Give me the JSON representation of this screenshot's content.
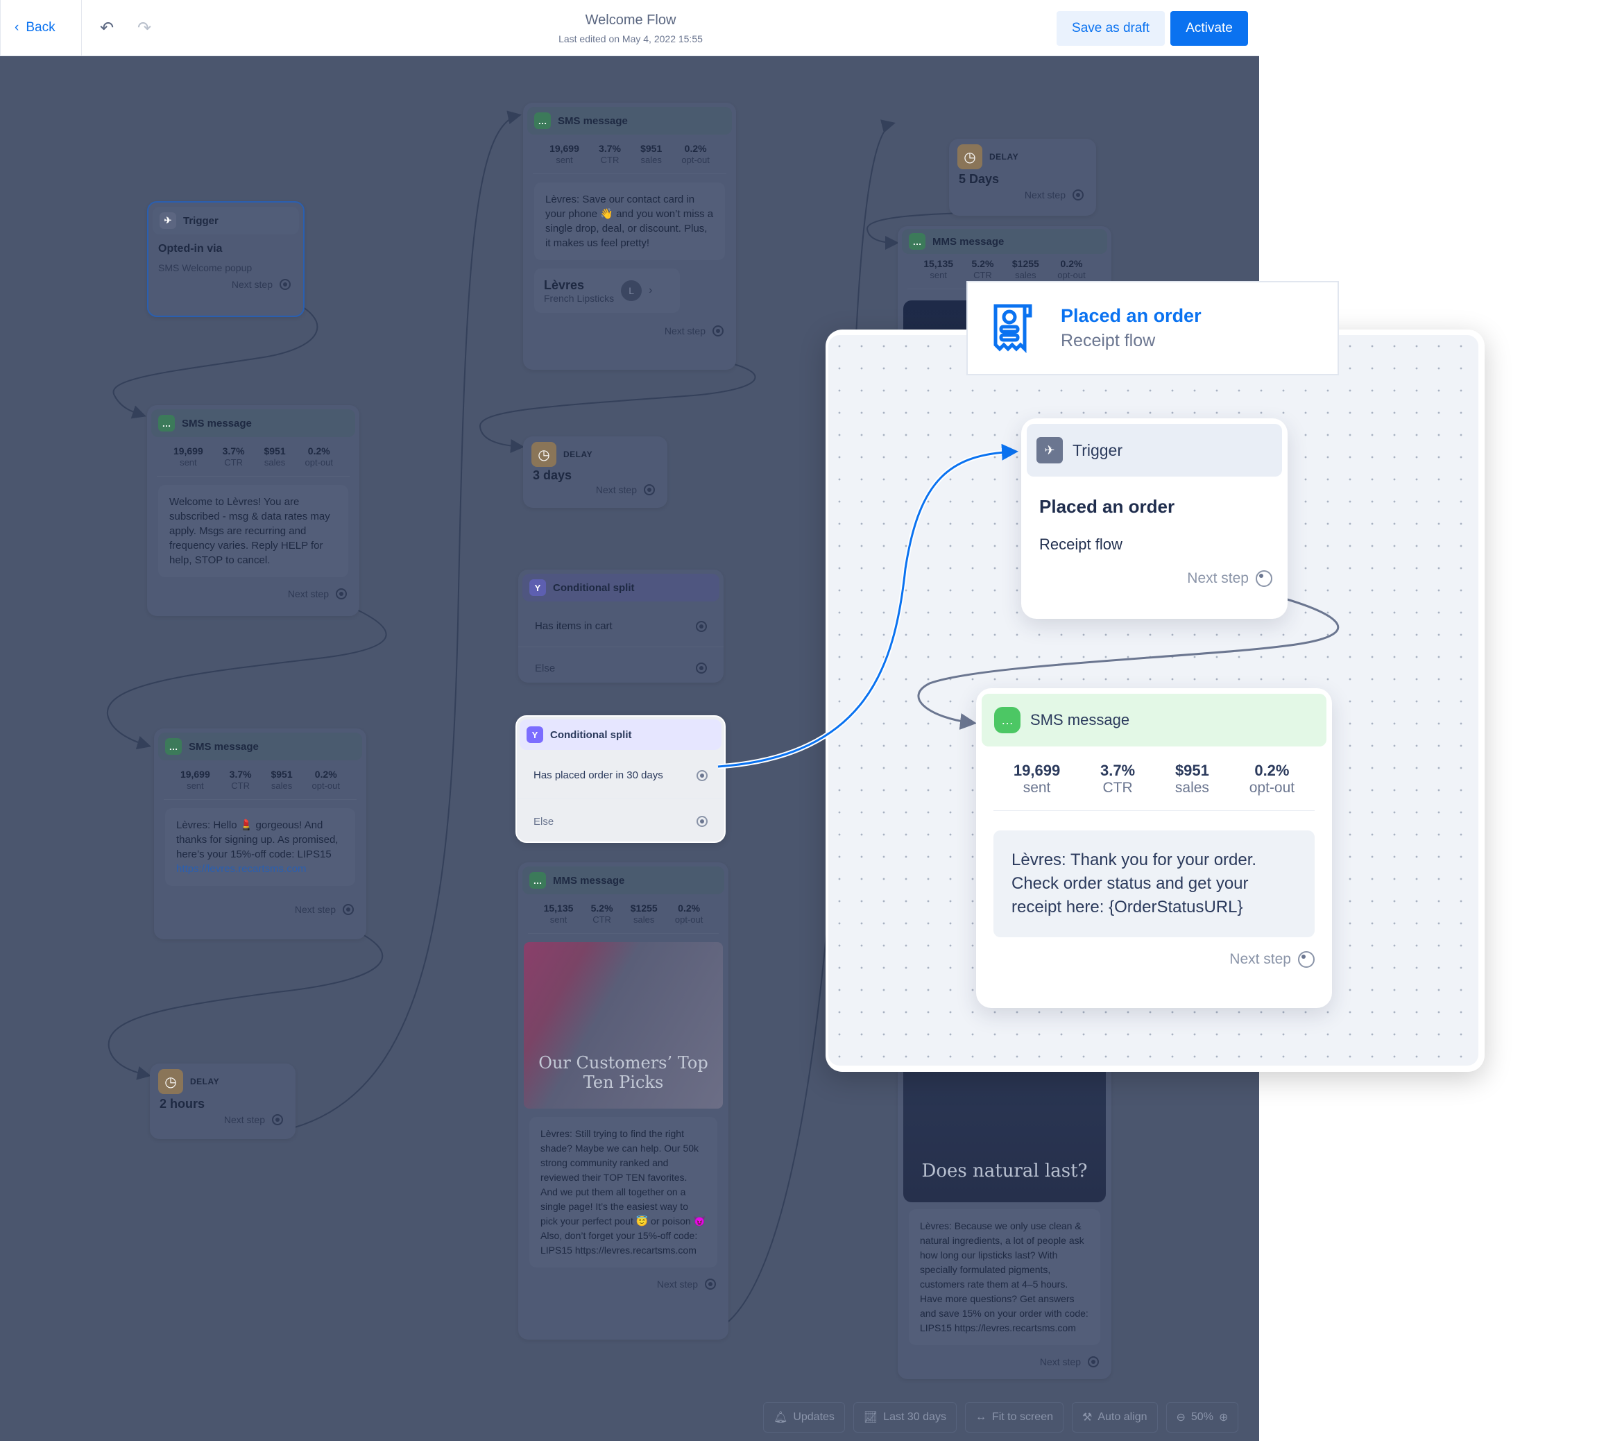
{
  "header": {
    "back": "Back",
    "title": "Welcome Flow",
    "subtitle": "Last edited on May 4, 2022 15:55",
    "save_draft": "Save as draft",
    "activate": "Activate"
  },
  "colors": {
    "accent": "#0a72f0",
    "sms_green": "#4cc764",
    "split_purple": "#7b6cff",
    "delay_orange": "#d59a4a"
  },
  "common": {
    "next_step": "Next step",
    "sent": "sent",
    "ctr": "CTR",
    "sales": "sales",
    "optout": "opt-out",
    "sms": "SMS message",
    "mms": "MMS message",
    "trigger": "Trigger",
    "delay": "DELAY",
    "split": "Conditional split",
    "else": "Else"
  },
  "nodes": {
    "trigger": {
      "title": "Opted-in via",
      "sub": "SMS Welcome popup"
    },
    "sms1": {
      "stats": [
        "19,699",
        "3.7%",
        "$951",
        "0.2%"
      ],
      "text": "Welcome to Lèvres! You are subscribed - msg & data rates may apply. Msgs are recurring and frequency varies. Reply HELP for help, STOP to cancel."
    },
    "sms2": {
      "stats": [
        "19,699",
        "3.7%",
        "$951",
        "0.2%"
      ],
      "text": "Lèvres: Hello 💄 gorgeous! And thanks for signing up. As promised, here’s your 15%-off code: LIPS15",
      "link": "https://levres.recartsms.com"
    },
    "delay1": {
      "value": "2 hours"
    },
    "sms3": {
      "stats": [
        "19,699",
        "3.7%",
        "$951",
        "0.2%"
      ],
      "text": "Lèvres: Save our contact card in your phone 👋 and you won’t miss a single drop, deal, or discount. Plus, it makes us feel pretty!",
      "contact_name": "Lèvres",
      "contact_sub": "French Lipsticks",
      "contact_initial": "L"
    },
    "delay2": {
      "value": "3 days"
    },
    "split1": {
      "cond": "Has items in cart"
    },
    "split2": {
      "cond": "Has placed order in 30 days"
    },
    "mms1": {
      "stats": [
        "15,135",
        "5.2%",
        "$1255",
        "0.2%"
      ],
      "image_text": "Our Customers’ Top Ten Picks",
      "text": "Lèvres: Still trying to find the right shade? Maybe we can help. Our 50k strong community ranked and reviewed their TOP TEN favorites. And we put them all together on a single page! It’s the easiest way to pick your perfect pout 😇 or poison 😈 Also, don’t forget your 15%-off code: LIPS15 https://levres.recartsms.com"
    },
    "delay3": {
      "value": "5 Days"
    },
    "mms2": {
      "stats": [
        "15,135",
        "5.2%",
        "$1255",
        "0.2%"
      ],
      "image_text": "Does natural last?",
      "text": "Lèvres: Because we only use clean & natural ingredients, a lot of people ask how long our lipsticks last? With specially formulated pigments, customers rate them at 4–5 hours. Have more questions? Get answers and save 15% on your order with code: LIPS15 https://levres.recartsms.com"
    }
  },
  "toolbar": {
    "updates": "Updates",
    "range": "Last 30 days",
    "fit": "Fit to screen",
    "align": "Auto align",
    "zoom": "50%"
  },
  "popup": {
    "title": "Placed an order",
    "subtitle": "Receipt flow",
    "trigger": {
      "title": "Placed an order",
      "sub": "Receipt flow"
    },
    "sms": {
      "stats": [
        "19,699",
        "3.7%",
        "$951",
        "0.2%"
      ],
      "text": "Lèvres: Thank you for your order. Check order status and get your receipt here: {OrderStatusURL}"
    }
  }
}
